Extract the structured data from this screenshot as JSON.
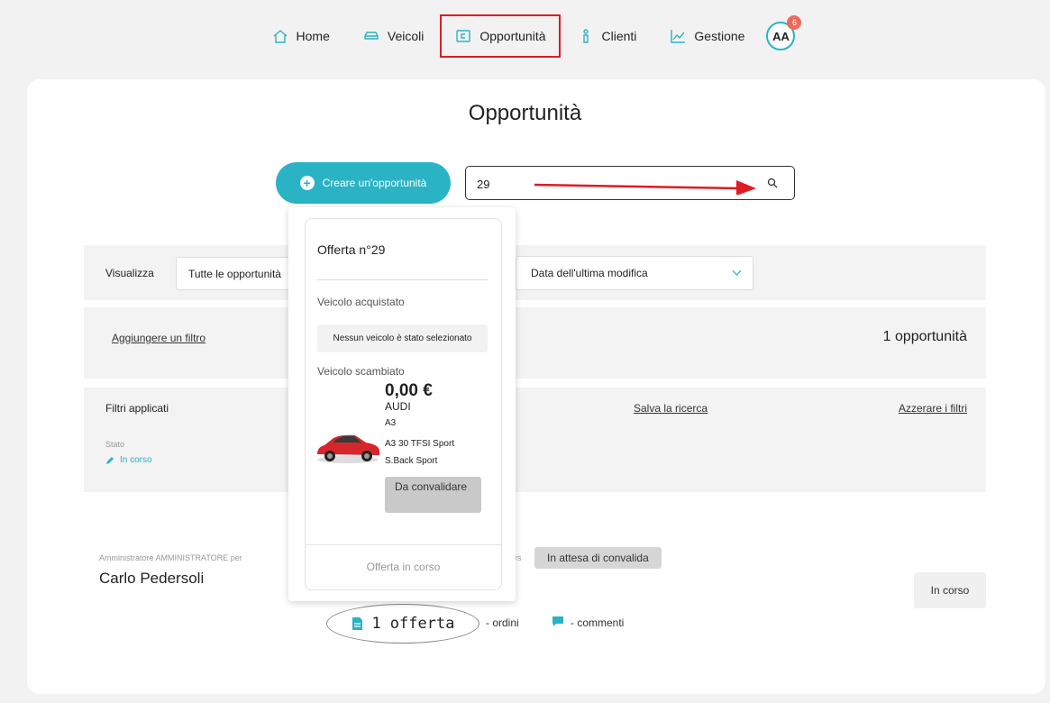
{
  "nav": {
    "items": [
      {
        "label": "Home",
        "icon": "home-icon"
      },
      {
        "label": "Veicoli",
        "icon": "car-icon"
      },
      {
        "label": "Opportunità",
        "icon": "wallet-icon"
      },
      {
        "label": "Clienti",
        "icon": "person-icon"
      },
      {
        "label": "Gestione",
        "icon": "chart-icon"
      }
    ],
    "avatar_initials": "AA",
    "notification_count": "6"
  },
  "page": {
    "title": "Opportunità"
  },
  "actions": {
    "create_label": "Creare un'opportunità"
  },
  "search": {
    "value": "29"
  },
  "filters_bar": {
    "view_label": "Visualizza",
    "view_select": "Tutte le opportunità",
    "sort_select": "Data dell'ultima modifica"
  },
  "filter_row": {
    "add_filter": "Aggiungere un filtro",
    "count": "1 opportunità"
  },
  "applied": {
    "label": "Filtri applicati",
    "save_search": "Salva la ricerca",
    "reset_filters": "Azzerare i filtri",
    "state_label": "Stato",
    "state_value": "In corso"
  },
  "opportunity": {
    "admin_line": "Amministratore AMMINISTRATORE per",
    "rs_text": "rs",
    "client_name": "Carlo Pedersoli",
    "status_badge": "In attesa di convalida",
    "status_button": "In corso",
    "offers_count": "1",
    "offers_label": "offerta",
    "orders_text": "- ordini",
    "comments_text": "- commenti"
  },
  "popup": {
    "title": "Offerta n°29",
    "purchased_label": "Veicolo acquistato",
    "no_vehicle": "Nessun veicolo è stato selezionato",
    "traded_label": "Veicolo scambiato",
    "price": "0,00 €",
    "brand": "AUDI",
    "model": "A3",
    "version": "A3 30 TFSI Sport S.Back Sport",
    "status": "Da convalidare",
    "footer": "Offerta in corso"
  },
  "colors": {
    "accent": "#2ab3c4",
    "highlight": "#e01b24",
    "badge": "#ee6a5a"
  }
}
